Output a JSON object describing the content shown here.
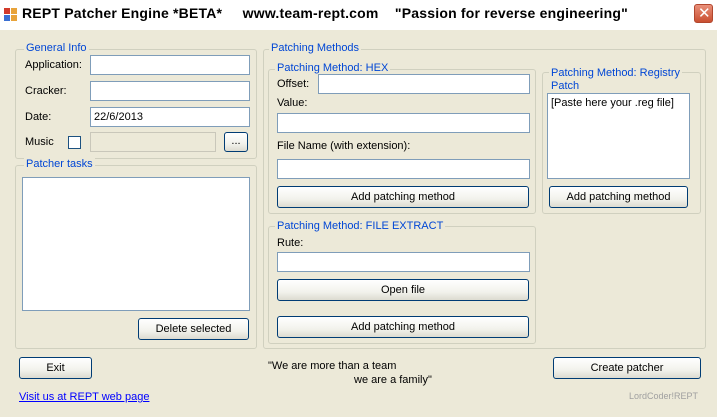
{
  "window": {
    "title": "REPT Patcher Engine *BETA*     www.team-rept.com    \"Passion for reverse engineering\"",
    "close_glyph": "✕",
    "app_icon": "app-grid-icon"
  },
  "general_info": {
    "legend": "General Info",
    "application_label": "Application:",
    "application_value": "",
    "cracker_label": "Cracker:",
    "cracker_value": "",
    "date_label": "Date:",
    "date_value": "22/6/2013",
    "music_label": "Music",
    "music_checked": false,
    "music_value": "",
    "browse_label": "..."
  },
  "patcher_tasks": {
    "legend": "Patcher tasks",
    "items": [],
    "delete_label": "Delete selected"
  },
  "patching_methods": {
    "legend": "Patching Methods",
    "hex": {
      "legend": "Patching Method: HEX",
      "offset_label": "Offset:",
      "offset_value": "",
      "value_label": "Value:",
      "value_value": "",
      "filename_label": "File Name (with extension):",
      "filename_value": "",
      "add_label": "Add patching method"
    },
    "registry": {
      "legend_line1": "Patching Method: Registry",
      "legend_line2": "Patch",
      "reg_text": "[Paste here your .reg file]",
      "add_label": "Add patching method"
    },
    "file_extract": {
      "legend": "Patching Method: FILE EXTRACT",
      "rute_label": "Rute:",
      "rute_value": "",
      "open_label": "Open file",
      "add_label": "Add patching method"
    }
  },
  "footer": {
    "exit_label": "Exit",
    "slogan_line1": "\"We are more than a team",
    "slogan_line2": "we are a family\"",
    "create_label": "Create patcher",
    "visit_link": "Visit us at REPT web page",
    "credit": "LordCoder!REPT"
  },
  "colors": {
    "group_label": "#0046d5",
    "window_bg": "#ece9d8",
    "link": "#0000ff"
  }
}
